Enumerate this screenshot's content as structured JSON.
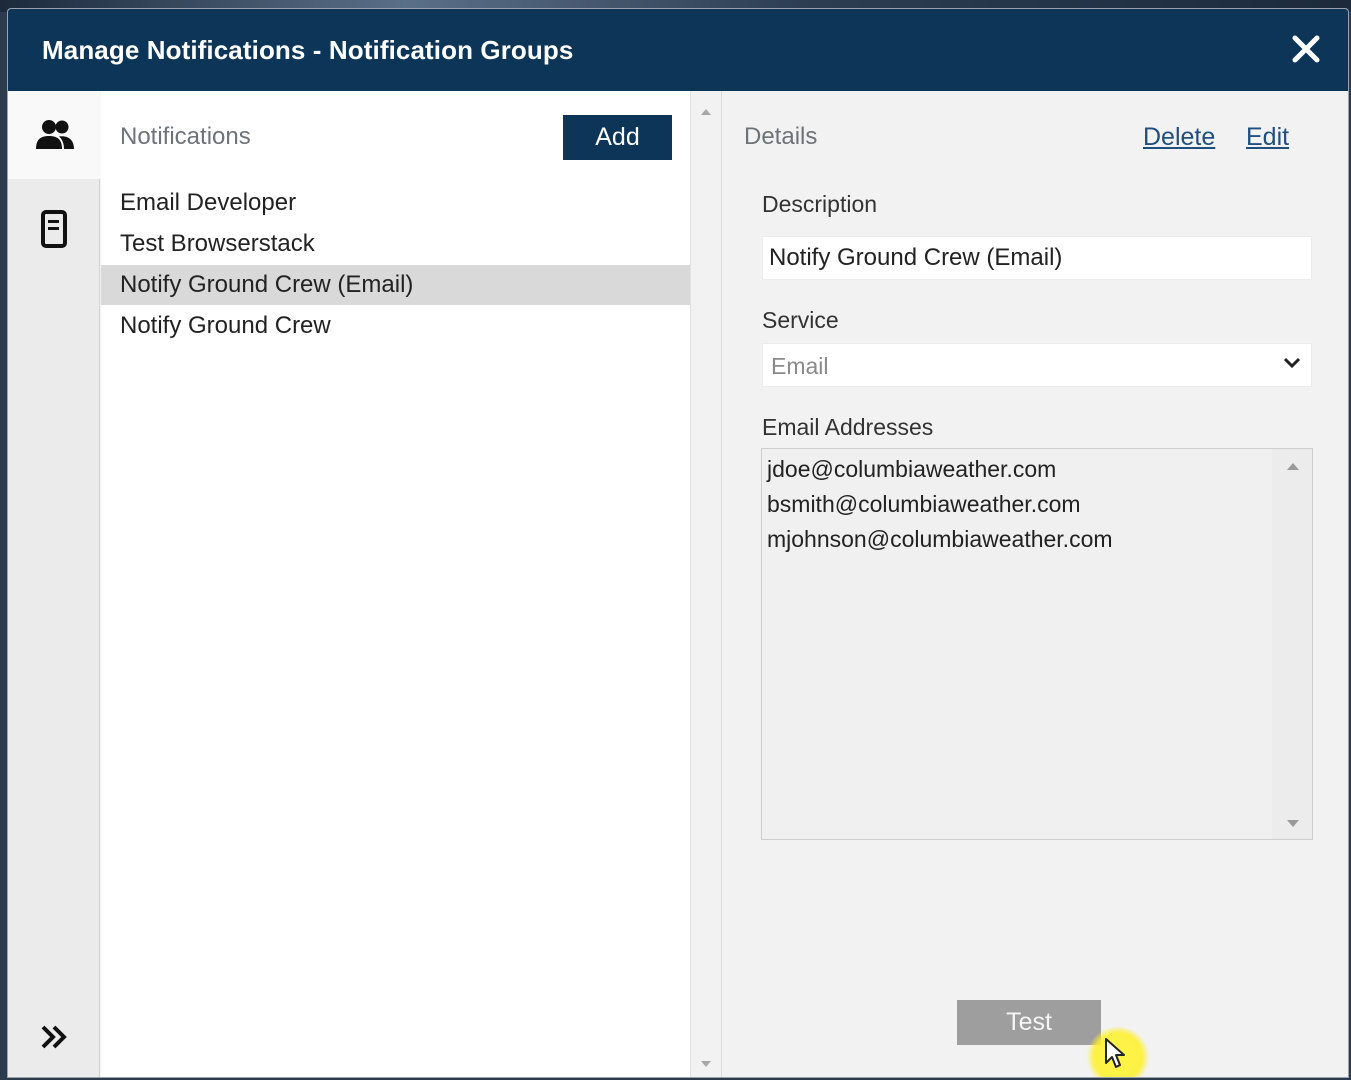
{
  "window": {
    "title": "Manage Notifications - Notification Groups"
  },
  "icons": {
    "close": "close-icon",
    "groups": "people-icon",
    "document": "document-icon",
    "expand": "double-chevron-right-icon",
    "select_chevron": "chevron-down-icon",
    "cursor": "mouse-pointer-icon"
  },
  "list_panel": {
    "heading": "Notifications",
    "add_label": "Add",
    "items": [
      {
        "label": "Email Developer",
        "selected": false
      },
      {
        "label": "Test Browserstack",
        "selected": false
      },
      {
        "label": "Notify Ground Crew (Email)",
        "selected": true
      },
      {
        "label": "Notify Ground Crew",
        "selected": false
      }
    ]
  },
  "details": {
    "heading": "Details",
    "delete_label": "Delete",
    "edit_label": "Edit",
    "description_label": "Description",
    "description_value": "Notify Ground Crew (Email)",
    "service_label": "Service",
    "service_value": "Email",
    "emails_label": "Email Addresses",
    "emails": [
      "jdoe@columbiaweather.com",
      "bsmith@columbiaweather.com",
      "mjohnson@columbiaweather.com"
    ],
    "test_label": "Test"
  },
  "colors": {
    "titlebar": "#0c3558",
    "primary_button": "#0c3558",
    "disabled_button": "#9e9e9e",
    "link": "#1f4f7e",
    "selected_row": "#d9d9d9",
    "cursor_highlight": "#fff23c"
  }
}
